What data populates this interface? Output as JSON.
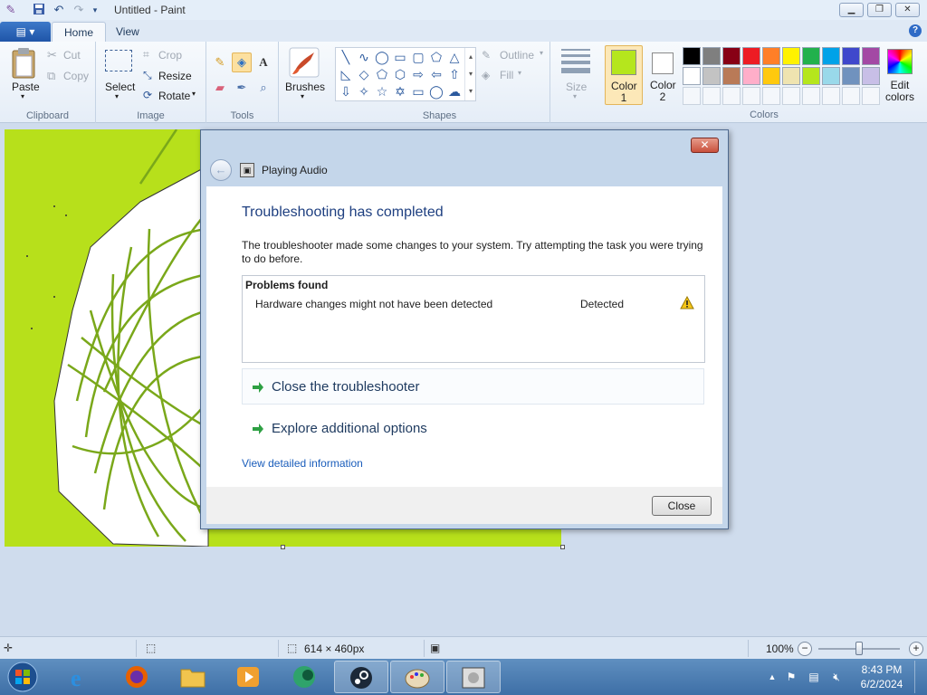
{
  "window": {
    "title": "Untitled - Paint",
    "minimize": "▁",
    "maximize": "❐",
    "close": "✕"
  },
  "ribbon_tabs": {
    "menu": "▤ ▾",
    "home": "Home",
    "view": "View"
  },
  "ribbon": {
    "clipboard": {
      "group": "Clipboard",
      "paste": "Paste",
      "cut": "Cut",
      "copy": "Copy"
    },
    "image": {
      "group": "Image",
      "select": "Select",
      "crop": "Crop",
      "resize": "Resize",
      "rotate": "Rotate"
    },
    "tools": {
      "group": "Tools"
    },
    "brushes": {
      "label": "Brushes"
    },
    "shapes": {
      "group": "Shapes",
      "outline": "Outline",
      "fill": "Fill"
    },
    "size": {
      "label": "Size"
    },
    "color1": {
      "label_line1": "Color",
      "label_line2": "1",
      "color": "#b5e61d"
    },
    "color2": {
      "label_line1": "Color",
      "label_line2": "2",
      "color": "#ffffff"
    },
    "colors_group": "Colors",
    "edit_colors": {
      "line1": "Edit",
      "line2": "colors"
    },
    "palette_row1": [
      "#000000",
      "#7f7f7f",
      "#880015",
      "#ed1c24",
      "#ff7f27",
      "#fff200",
      "#22b14c",
      "#00a2e8",
      "#3f48cc",
      "#a349a4"
    ],
    "palette_row2": [
      "#ffffff",
      "#c3c3c3",
      "#b97a57",
      "#ffaec9",
      "#ffc90e",
      "#efe4b0",
      "#b5e61d",
      "#99d9ea",
      "#7092be",
      "#c8bfe7"
    ]
  },
  "dialog": {
    "title": "Playing Audio",
    "heading": "Troubleshooting has completed",
    "description": "The troubleshooter made some changes to your system. Try attempting the task you were trying to do before.",
    "problems_header": "Problems found",
    "problem": "Hardware changes might not have been detected",
    "problem_status": "Detected",
    "option_close": "Close the troubleshooter",
    "option_explore": "Explore additional options",
    "view_details": "View detailed information",
    "close_button": "Close"
  },
  "statusbar": {
    "image_size": "614 × 460px",
    "zoom": "100%",
    "zoom_level": 0.5
  },
  "taskbar": {
    "time": "8:43 PM",
    "date": "6/2/2024",
    "apps": [
      "start",
      "internet-explorer",
      "firefox",
      "file-explorer",
      "media-player",
      "app-green",
      "steam",
      "paint",
      "troubleshooter"
    ]
  }
}
